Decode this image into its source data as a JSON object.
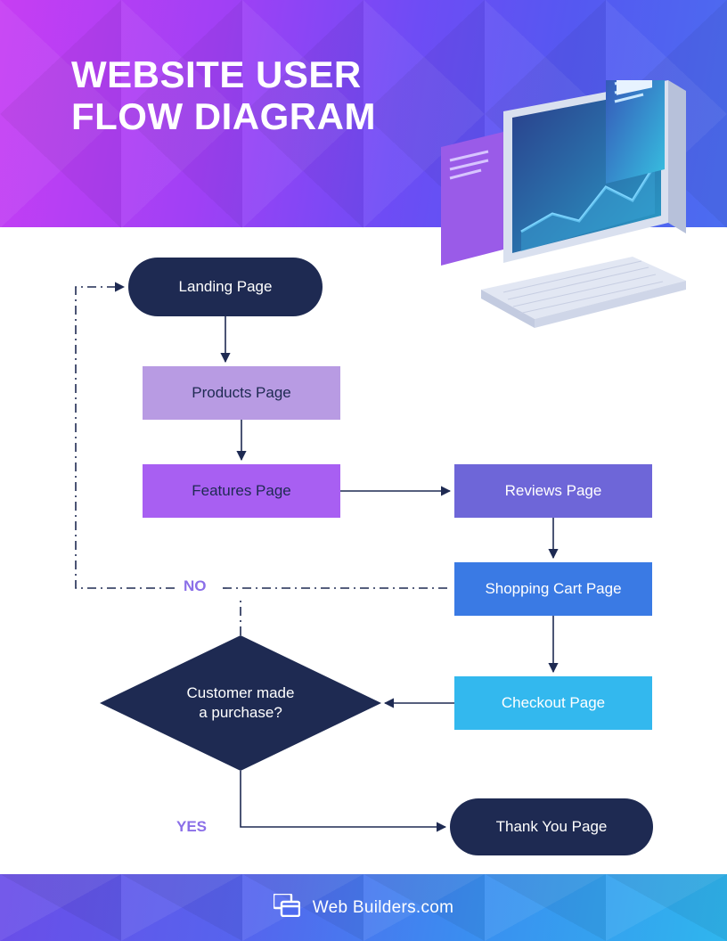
{
  "title_line1": "WEBSITE USER",
  "title_line2": "FLOW DIAGRAM",
  "nodes": {
    "landing": "Landing Page",
    "products": "Products Page",
    "features": "Features Page",
    "reviews": "Reviews Page",
    "cart": "Shopping Cart Page",
    "checkout": "Checkout Page",
    "thankyou": "Thank You Page",
    "decision_l1": "Customer made",
    "decision_l2": "a purchase?"
  },
  "edges": {
    "no": "NO",
    "yes": "YES"
  },
  "footer": {
    "brand": "Web Builders.com"
  },
  "flow": [
    {
      "from": "landing",
      "to": "products"
    },
    {
      "from": "products",
      "to": "features"
    },
    {
      "from": "features",
      "to": "reviews"
    },
    {
      "from": "reviews",
      "to": "cart"
    },
    {
      "from": "cart",
      "to": "checkout"
    },
    {
      "from": "checkout",
      "to": "decision"
    },
    {
      "from": "decision",
      "to": "landing",
      "label": "NO"
    },
    {
      "from": "decision",
      "to": "thankyou",
      "label": "YES"
    }
  ]
}
